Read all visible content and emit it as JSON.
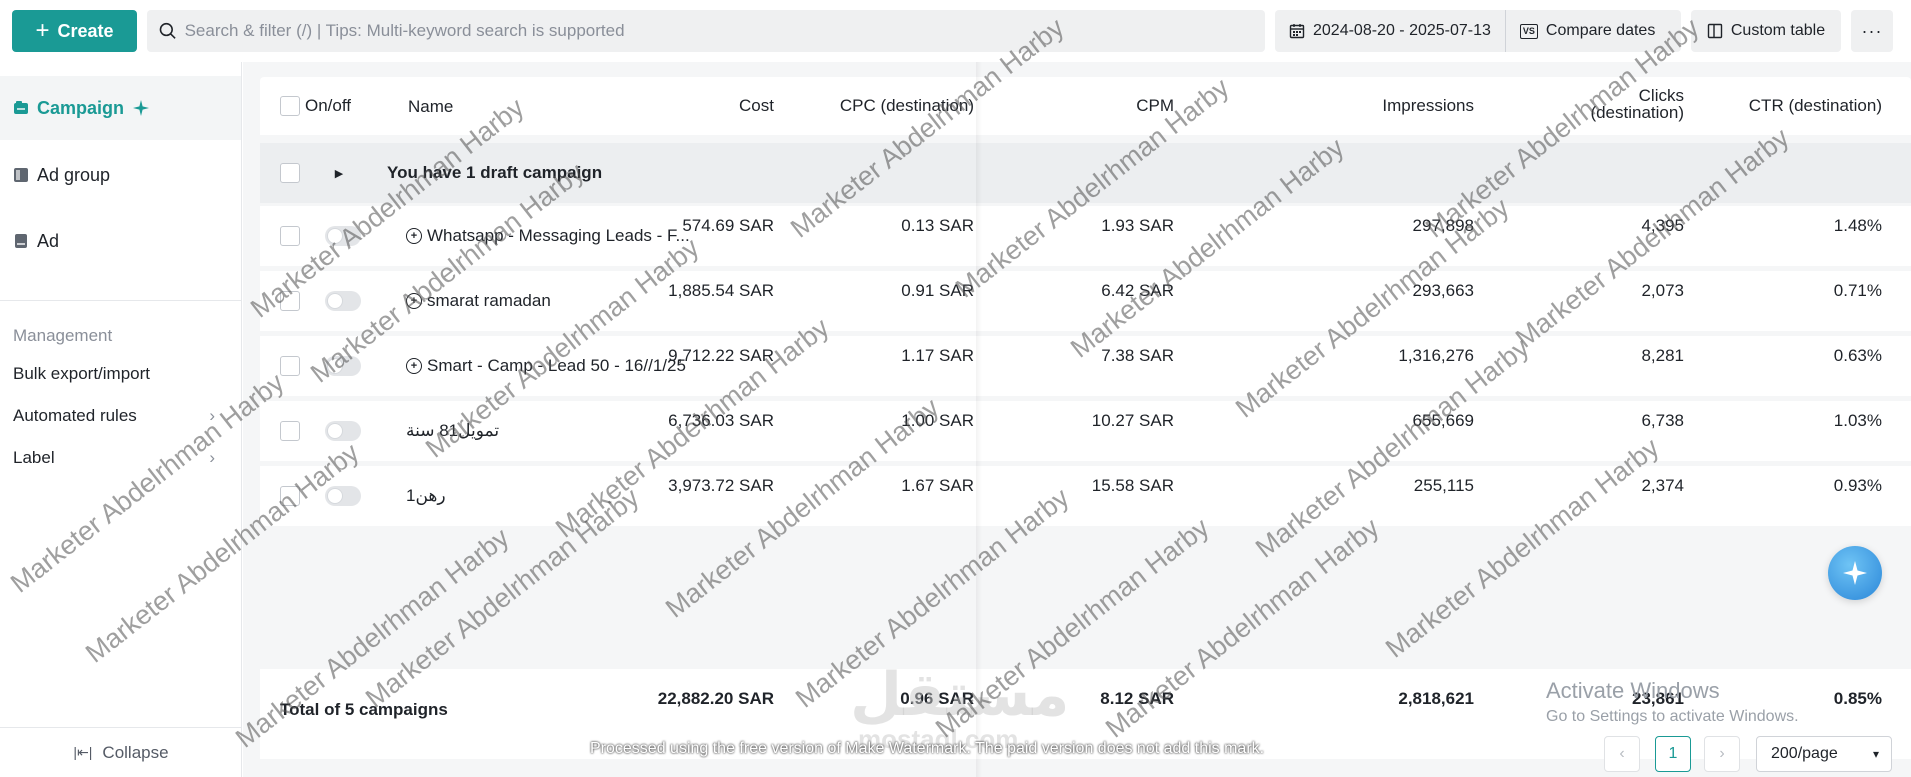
{
  "toolbar": {
    "create_label": "Create",
    "search_placeholder": "Search & filter (/) | Tips: Multi-keyword search is supported",
    "date_range": "2024-08-20 - 2025-07-13",
    "compare_label": "Compare dates",
    "compare_badge": "VS",
    "custom_table_label": "Custom table",
    "more_label": "···"
  },
  "sidebar": {
    "levels": [
      {
        "label": "Campaign",
        "active": true
      },
      {
        "label": "Ad group",
        "active": false
      },
      {
        "label": "Ad",
        "active": false
      }
    ],
    "management_heading": "Management",
    "links": [
      {
        "label": "Bulk export/import",
        "has_arrow": false
      },
      {
        "label": "Automated rules",
        "has_arrow": true
      },
      {
        "label": "Label",
        "has_arrow": true
      }
    ],
    "collapse_label": "Collapse"
  },
  "table": {
    "columns": {
      "onoff": "On/off",
      "name": "Name",
      "cost": "Cost",
      "cpc": "CPC (destination)",
      "cpm": "CPM",
      "impressions": "Impressions",
      "clicks_line1": "Clicks",
      "clicks_line2": "(destination)",
      "ctr": "CTR (destination)"
    },
    "draft_row": "You have 1 draft campaign",
    "rows": [
      {
        "name": "Whatsapp - Messaging Leads - F...",
        "cost": "574.69 SAR",
        "cpc": "0.13 SAR",
        "cpm": "1.93 SAR",
        "impressions": "297,898",
        "clicks": "4,395",
        "ctr": "1.48%",
        "has_icon": true
      },
      {
        "name": "smarat ramadan",
        "cost": "1,885.54 SAR",
        "cpc": "0.91 SAR",
        "cpm": "6.42 SAR",
        "impressions": "293,663",
        "clicks": "2,073",
        "ctr": "0.71%",
        "has_icon": true
      },
      {
        "name": "Smart - Camp - Lead 50 - 16//1/25",
        "cost": "9,712.22 SAR",
        "cpc": "1.17 SAR",
        "cpm": "7.38 SAR",
        "impressions": "1,316,276",
        "clicks": "8,281",
        "ctr": "0.63%",
        "has_icon": true
      },
      {
        "name": "تمويل81 سنة",
        "cost": "6,736.03 SAR",
        "cpc": "1.00 SAR",
        "cpm": "10.27 SAR",
        "impressions": "655,669",
        "clicks": "6,738",
        "ctr": "1.03%",
        "has_icon": false
      },
      {
        "name": "رهن1",
        "cost": "3,973.72 SAR",
        "cpc": "1.67 SAR",
        "cpm": "15.58 SAR",
        "impressions": "255,115",
        "clicks": "2,374",
        "ctr": "0.93%",
        "has_icon": false
      }
    ],
    "total": {
      "label": "Total of 5 campaigns",
      "cost": "22,882.20 SAR",
      "cpc": "0.96 SAR",
      "cpm": "8.12 SAR",
      "impressions": "2,818,621",
      "clicks": "23,861",
      "ctr": "0.85%"
    }
  },
  "pagination": {
    "prev": "‹",
    "current_page": "1",
    "next": "›",
    "page_size": "200/page"
  },
  "overlays": {
    "activate_title": "Activate Windows",
    "activate_sub": "Go to Settings to activate Windows.",
    "processed_notice": "Processed using the free version of Make Watermark. The paid version does not add this mark.",
    "watermark_text": "Marketer Abdelrhman Harby",
    "mostaql_text": "مستقل",
    "mostaql_sub": "mostaql.com"
  },
  "colors": {
    "accent": "#1a9a95",
    "background": "#f5f6f7",
    "text": "#1f2329",
    "muted": "#8a8f99"
  }
}
